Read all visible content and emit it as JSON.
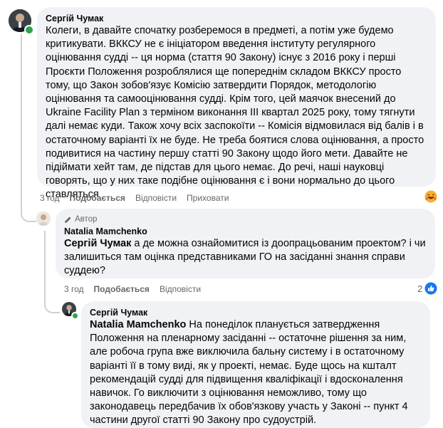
{
  "comment1": {
    "author": "Сергій Чумак",
    "text": "Колеги, в давайте спочатку розберемося в предметі, а потім уже будемо критикувати. ВККСУ не є ініціатором введення інституту регулярного оцінювання судді -- ця норма (стаття 90 Закону) існує з 2016 року і перші Проєкти Положення розроблялися ще попереднім складом ВККСУ просто тому, що Закон зобов'язує Комісію затвердити Порядок, методологію оцінювання та самооцінювання судді. Крім того, цей маячок внесений до Ukraine Facility Plan з терміном виконання III квартал 2025 року, тому тягнути далі немає куди. Також хочу всіх заспокоїти -- Комісія відмовилася від балів і в остаточному варіанті їх не буде. Не треба боятися слова оцінювання, а просто подивитися на частину першу статті 90 Закону щодо його мети. Давайте не підіймати хейт там, де підстав для цього немає. До речі, наші науковці говорять, що у них таке подібне оцінювання є і вони нормально до цього ставляться",
    "time": "3 год",
    "like": "Подобається",
    "reply": "Відповісти",
    "hide": "Приховати",
    "reaction_icon": "haha-emoji-icon"
  },
  "comment2": {
    "badge": "Автор",
    "author": "Natalia Mamchenko",
    "mention": "Сергій Чумак",
    "text": " а де можна ознайомитися із доопрацьованим проектом? і чи залишиться там оцінка представниками ГО на засіданні знання справи суддею?",
    "time": "3 год",
    "like": "Подобається",
    "reply": "Відповісти",
    "reaction_count": "2",
    "reaction_icon": "like-icon"
  },
  "comment3": {
    "author": "Сергій Чумак",
    "mention": "Natalia Mamchenko",
    "text": " На понеділок планується затвердження Положення на пленарному засіданні -- остаточне рішення за ним, але робоча група вже виключила бальну систему і в остаточному варіанті її в тому виді, як у проекті, немає. Буде щось на кшталт рекомендацій судді для підвищення кваліфікації і вдосконалення навичок. Го виключити з оцінювання неможливо, тому що законодавець передбачив їх обов'язкову участь у Законі -- пункт 4 частини другої статті 90 Закону про судоустрій."
  },
  "colors": {
    "bubble": "#f0f2f5",
    "meta": "#65676b",
    "online": "#31a24c",
    "like_blue": "#1877f2"
  }
}
